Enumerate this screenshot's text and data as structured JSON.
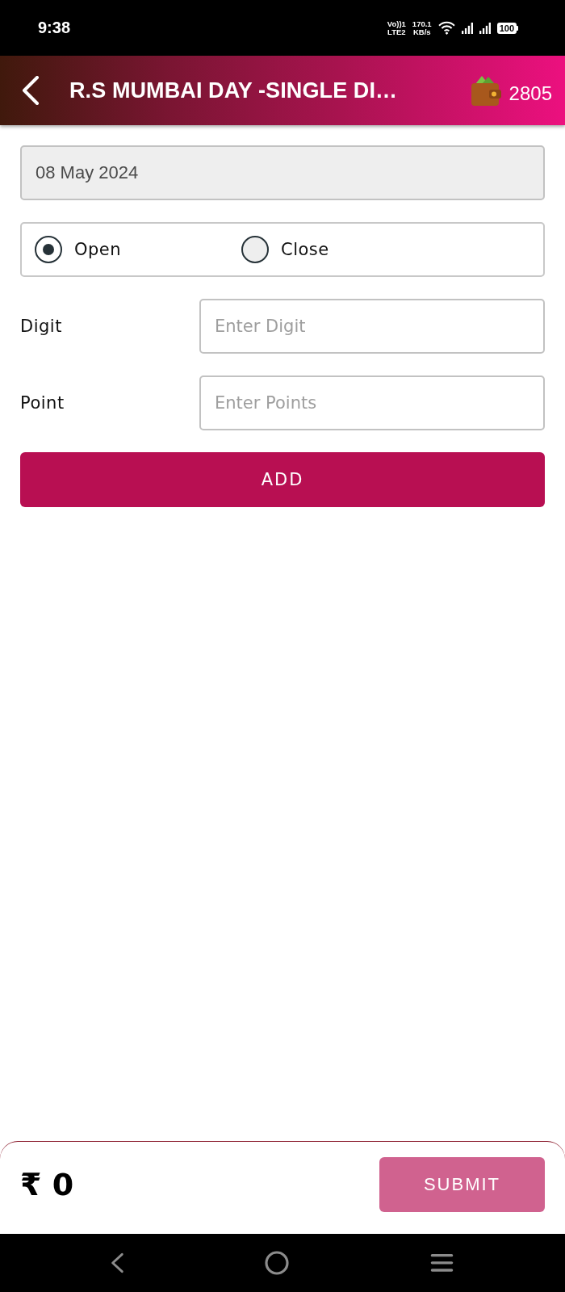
{
  "status_bar": {
    "time": "9:38",
    "volte": "Vo))1",
    "network": "LTE2",
    "speed_value": "170.1",
    "speed_unit": "KB/s",
    "battery": "100"
  },
  "header": {
    "title": "R.S MUMBAI DAY -SINGLE DI…",
    "wallet_balance": "2805"
  },
  "date_field": {
    "value": "08 May 2024"
  },
  "session_options": [
    {
      "label": "Open",
      "selected": true
    },
    {
      "label": "Close",
      "selected": false
    }
  ],
  "fields": [
    {
      "label": "Digit",
      "placeholder": "Enter Digit"
    },
    {
      "label": "Point",
      "placeholder": "Enter Points"
    }
  ],
  "add_button": {
    "label": "ADD"
  },
  "footer": {
    "total": "₹ 0",
    "submit_button": {
      "label": "SUBMIT",
      "disabled": true
    }
  }
}
